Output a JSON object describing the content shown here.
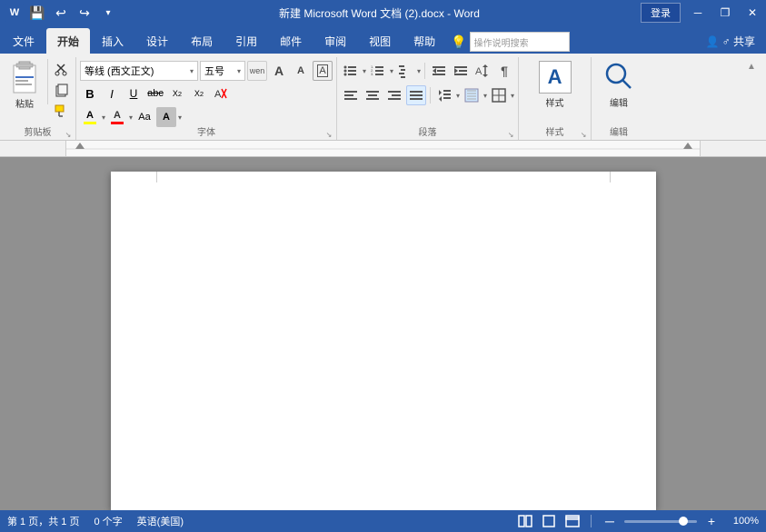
{
  "titlebar": {
    "title": "新建 Microsoft Word 文档 (2).docx - Word",
    "app": "Word",
    "login_label": "登录",
    "minimize": "─",
    "restore": "❐",
    "close": "✕",
    "ribbon_collapse": "🔧"
  },
  "tabs": {
    "file": "文件",
    "home": "开始",
    "insert": "插入",
    "design": "设计",
    "layout": "布局",
    "references": "引用",
    "mailings": "邮件",
    "review": "审阅",
    "view": "视图",
    "help": "帮助",
    "hint": "操作说明搜索",
    "share": "♂ 共享"
  },
  "ribbon": {
    "clipboard": {
      "label": "剪贴板",
      "paste": "粘贴",
      "cut": "✂",
      "copy": "⿻",
      "format_painter": "🖌"
    },
    "font": {
      "label": "字体",
      "font_name": "等线 (西文正文)",
      "font_size": "五号",
      "bold": "B",
      "italic": "I",
      "underline": "U",
      "strikethrough": "abc",
      "subscript": "X₂",
      "superscript": "X²",
      "clear_format": "A",
      "text_color": "A",
      "highlight": "A",
      "font_color": "A",
      "font_size_up": "A",
      "font_size_down": "A",
      "change_case": "Aa",
      "phonetic": "wen",
      "char_border": "A"
    },
    "paragraph": {
      "label": "段落",
      "bullet_list": "≡",
      "numbered_list": "≡",
      "outline_list": "≡",
      "decrease_indent": "⟵",
      "increase_indent": "⟶",
      "sort": "↕A",
      "show_marks": "¶",
      "align_left": "≡",
      "align_center": "≡",
      "align_right": "≡",
      "justify": "≡",
      "line_spacing": "↕",
      "shading": "░",
      "borders": "⊞"
    },
    "styles": {
      "label": "样式",
      "style_icon": "A"
    },
    "editing": {
      "label": "编辑",
      "search_icon": "🔍"
    }
  },
  "statusbar": {
    "page_info": "第 1 页，共 1 页",
    "word_count": "0 个字",
    "language": "英语(美国)",
    "zoom": "100%",
    "zoom_minus": "─",
    "zoom_plus": "+"
  }
}
